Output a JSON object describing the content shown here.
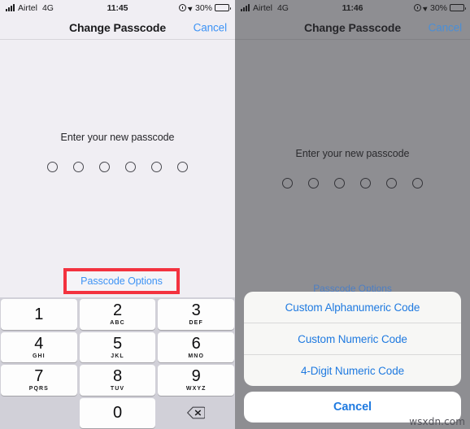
{
  "panels": {
    "left": {
      "status_bar": {
        "signal_icon": "signal-bars-icon",
        "carrier": "Airtel",
        "network": "4G",
        "time": "11:45",
        "alarm_icon": "alarm-clock-icon",
        "location_icon": "location-arrow-icon",
        "battery_percent": "30%",
        "battery_icon": "battery-icon"
      },
      "nav": {
        "title": "Change Passcode",
        "cancel_label": "Cancel"
      },
      "passcode": {
        "prompt": "Enter your new passcode",
        "dot_count": 6,
        "filled_count": 0
      },
      "passcode_options_label": "Passcode Options",
      "highlight_color": "#f3323f",
      "keypad": {
        "keys": [
          {
            "digit": "1",
            "letters": ""
          },
          {
            "digit": "2",
            "letters": "ABC"
          },
          {
            "digit": "3",
            "letters": "DEF"
          },
          {
            "digit": "4",
            "letters": "GHI"
          },
          {
            "digit": "5",
            "letters": "JKL"
          },
          {
            "digit": "6",
            "letters": "MNO"
          },
          {
            "digit": "7",
            "letters": "PQRS"
          },
          {
            "digit": "8",
            "letters": "TUV"
          },
          {
            "digit": "9",
            "letters": "WXYZ"
          },
          {
            "digit": "0",
            "letters": ""
          }
        ],
        "delete_icon": "backspace-delete-icon"
      }
    },
    "right": {
      "status_bar": {
        "signal_icon": "signal-bars-icon",
        "carrier": "Airtel",
        "network": "4G",
        "time": "11:46",
        "alarm_icon": "alarm-clock-icon",
        "location_icon": "location-arrow-icon",
        "battery_percent": "30%",
        "battery_icon": "battery-icon"
      },
      "nav": {
        "title": "Change Passcode",
        "cancel_label": "Cancel"
      },
      "passcode": {
        "prompt": "Enter your new passcode",
        "dot_count": 6,
        "filled_count": 0
      },
      "passcode_options_label": "Passcode Options",
      "action_sheet": {
        "options": [
          "Custom Alphanumeric Code",
          "Custom Numeric Code",
          "4-Digit Numeric Code"
        ],
        "cancel_label": "Cancel"
      }
    }
  },
  "watermark": "wsxdn.com",
  "colors": {
    "ios_blue": "#3d93f5",
    "sheet_blue": "#1f7ae0",
    "highlight_red": "#f3323f",
    "left_bg": "#f0eef3",
    "right_dim_bg": "#8e8e92",
    "keypad_bg": "#d1d0d8",
    "key_face": "#fdfdfd"
  }
}
